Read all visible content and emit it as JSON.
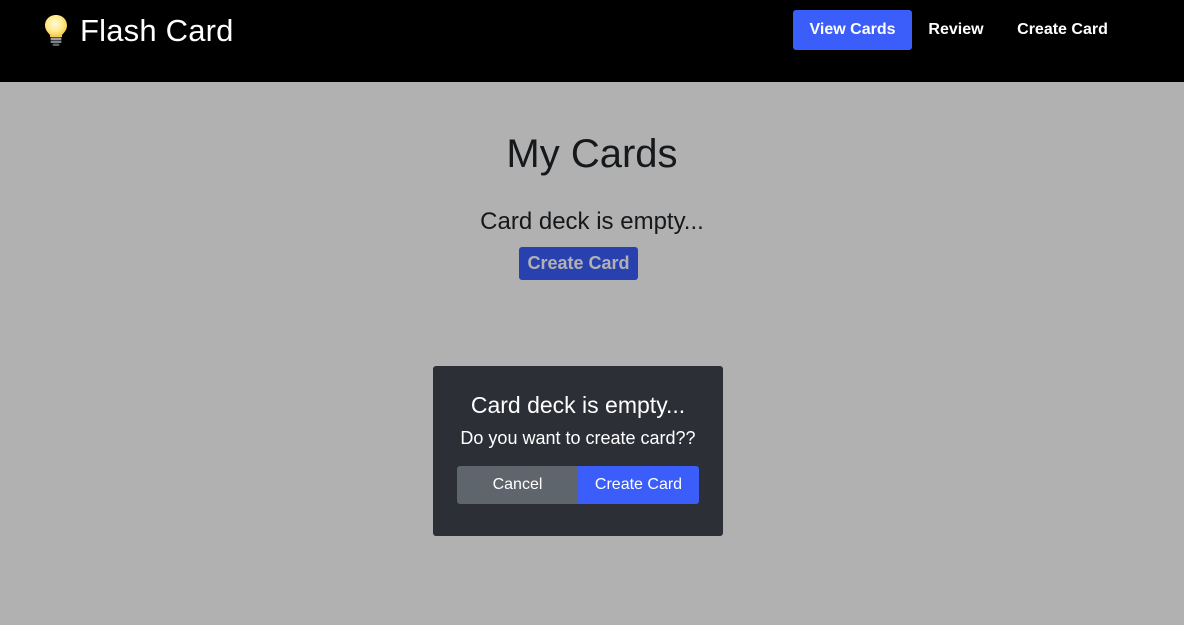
{
  "app": {
    "brand_label": "Flash Card",
    "brand_icon": "lightbulb-icon"
  },
  "nav": {
    "items": [
      {
        "label": "View Cards",
        "active": true
      },
      {
        "label": "Review",
        "active": false
      },
      {
        "label": "Create Card",
        "active": false
      }
    ]
  },
  "main": {
    "title": "My Cards",
    "empty_message": "Card deck is empty...",
    "create_button_label": "Create Card"
  },
  "dialog": {
    "title": "Card deck is empty...",
    "question": "Do you want to create card??",
    "cancel_label": "Cancel",
    "confirm_label": "Create Card"
  },
  "colors": {
    "accent": "#3b5efb",
    "navbar": "#000000",
    "dialog_bg": "#2d2f36",
    "cancel_bg": "#5f656d"
  }
}
